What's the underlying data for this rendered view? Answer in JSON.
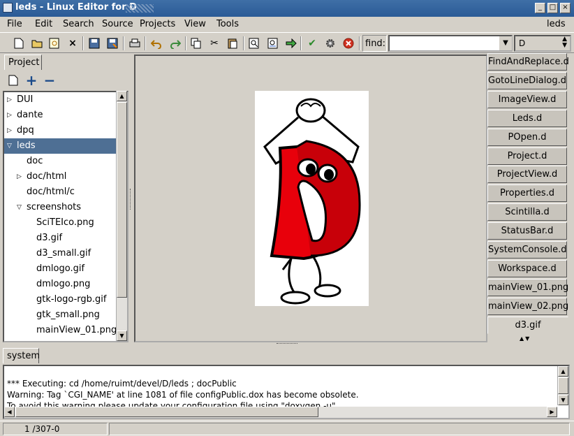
{
  "window": {
    "title": "leds - Linux Editor for D"
  },
  "menu": {
    "items": [
      {
        "label": "File"
      },
      {
        "label": "Edit"
      },
      {
        "label": "Search"
      },
      {
        "label": "Source"
      },
      {
        "label": "Projects"
      },
      {
        "label": "View"
      },
      {
        "label": "Tools"
      }
    ],
    "right_label": "leds"
  },
  "toolbar": {
    "find_label": "find:",
    "find_value": "",
    "language": "D"
  },
  "project_panel": {
    "tab_label": "Project",
    "tree": [
      {
        "label": "DUI",
        "expander": "collapsed",
        "indent": 0
      },
      {
        "label": "dante",
        "expander": "collapsed",
        "indent": 0
      },
      {
        "label": "dpq",
        "expander": "collapsed",
        "indent": 0
      },
      {
        "label": "leds",
        "expander": "expanded",
        "indent": 0,
        "selected": true
      },
      {
        "label": "doc",
        "expander": "none",
        "indent": 1
      },
      {
        "label": "doc/html",
        "expander": "collapsed",
        "indent": 1
      },
      {
        "label": "doc/html/c",
        "expander": "none",
        "indent": 1
      },
      {
        "label": "screenshots",
        "expander": "expanded",
        "indent": 1
      },
      {
        "label": "SciTEIco.png",
        "expander": "none",
        "indent": 2
      },
      {
        "label": "d3.gif",
        "expander": "none",
        "indent": 2
      },
      {
        "label": "d3_small.gif",
        "expander": "none",
        "indent": 2
      },
      {
        "label": "dmlogo.gif",
        "expander": "none",
        "indent": 2
      },
      {
        "label": "dmlogo.png",
        "expander": "none",
        "indent": 2
      },
      {
        "label": "gtk-logo-rgb.gif",
        "expander": "none",
        "indent": 2
      },
      {
        "label": "gtk_small.png",
        "expander": "none",
        "indent": 2
      },
      {
        "label": "mainView_01.png",
        "expander": "none",
        "indent": 2
      }
    ]
  },
  "file_tabs": [
    "FindAndReplace.d",
    "GotoLineDialog.d",
    "ImageView.d",
    "Leds.d",
    "POpen.d",
    "Project.d",
    "ProjectView.d",
    "Properties.d",
    "Scintilla.d",
    "StatusBar.d",
    "SystemConsole.d",
    "Workspace.d",
    "mainView_01.png",
    "mainView_02.png",
    "d3.gif"
  ],
  "active_file_tab": "d3.gif",
  "console": {
    "tab_label": "system",
    "lines": [
      "*** Executing: cd /home/ruimt/devel/D/leds ; docPublic",
      "Warning: Tag `CGI_NAME' at line 1081 of file configPublic.dox has become obsolete.",
      "To avoid this warning please update your configuration file using \"doxygen -u\""
    ]
  },
  "status": {
    "position": "1 /307-0"
  },
  "colors": {
    "title_bar": "#2a5a96",
    "selection": "#4e6f94",
    "mascot_red": "#e8000b"
  }
}
